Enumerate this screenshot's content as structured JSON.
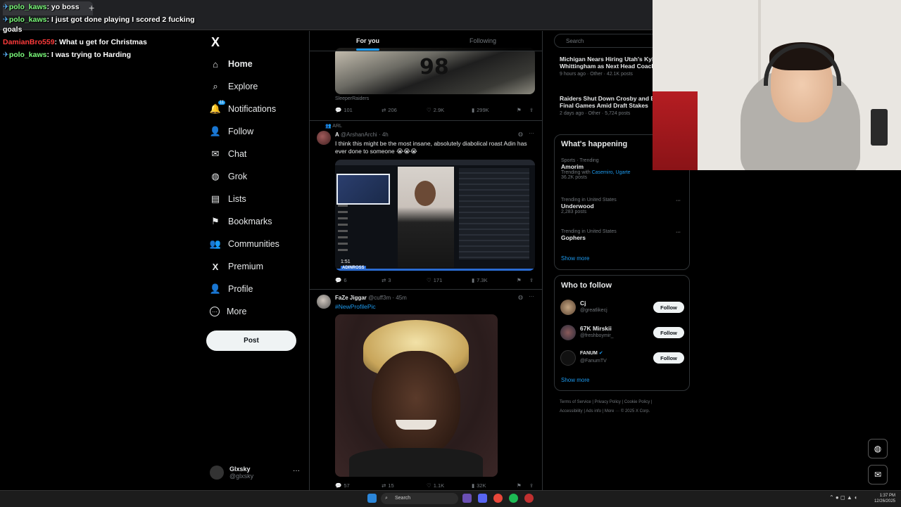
{
  "browser": {
    "tab_label": "",
    "new_tab": "+"
  },
  "chat": [
    {
      "user": "polo_kaws",
      "sep": ":",
      "text": "yo boss",
      "user_color": "green"
    },
    {
      "user": "polo_kaws",
      "sep": ":",
      "text": "I just got done playing I scored 2 fucking",
      "user_color": "green"
    },
    {
      "user": "",
      "sep": "",
      "text": "goals",
      "user_color": "green"
    },
    {
      "user": "DamianBro559",
      "sep": ":",
      "text": "What u get for Christmas",
      "user_color": "red"
    },
    {
      "user": "polo_kaws",
      "sep": ":",
      "text": "I was trying to Harding",
      "user_color": "green"
    }
  ],
  "nav": {
    "logo": "X",
    "items": [
      {
        "label": "Home",
        "icon": "home-icon",
        "glyph": "⌂"
      },
      {
        "label": "Explore",
        "icon": "search-icon",
        "glyph": "⌕"
      },
      {
        "label": "Notifications",
        "icon": "bell-icon",
        "glyph": "🔔"
      },
      {
        "label": "Follow",
        "icon": "add-user-icon",
        "glyph": "👤"
      },
      {
        "label": "Chat",
        "icon": "mail-icon",
        "glyph": "✉"
      },
      {
        "label": "Grok",
        "icon": "grok-icon",
        "glyph": "◍"
      },
      {
        "label": "Lists",
        "icon": "list-icon",
        "glyph": "▤"
      },
      {
        "label": "Bookmarks",
        "icon": "bookmark-icon",
        "glyph": "⚑"
      },
      {
        "label": "Communities",
        "icon": "communities-icon",
        "glyph": "👥"
      },
      {
        "label": "Premium",
        "icon": "x-icon",
        "glyph": "X"
      },
      {
        "label": "Profile",
        "icon": "profile-icon",
        "glyph": "👤"
      },
      {
        "label": "More",
        "icon": "more-icon",
        "glyph": "⋯"
      }
    ],
    "notif_badge": "11",
    "post_label": "Post",
    "account": {
      "name": "Glxsky",
      "handle": "@glxsky",
      "more": "···"
    }
  },
  "feed": {
    "tabs": {
      "for_you": "For you",
      "following": "Following"
    },
    "post0": {
      "source": "SleeperRaiders",
      "jersey": "98",
      "stats": {
        "replies": "101",
        "reposts": "206",
        "likes": "2.9K",
        "views": "299K"
      }
    },
    "post1": {
      "context": "ARL",
      "name": "A",
      "handle": "@ArshanArchi",
      "time": "· 4h",
      "text": "I think this might be the most insane, absolutely diabolical roast Adin has ever done to someone 😭😭😭",
      "video_time": "1:51",
      "overlay_text": "ADINROSS",
      "stats": {
        "replies": "6",
        "reposts": "3",
        "likes": "171",
        "views": "7.3K"
      }
    },
    "post2": {
      "name": "FaZe Jiggar",
      "handle": "@cuff3m",
      "time": "· 45m",
      "text": "#NewProfilePic",
      "stats": {
        "replies": "57",
        "reposts": "15",
        "likes": "1.1K",
        "views": "32K"
      }
    }
  },
  "right": {
    "search_placeholder": "Search",
    "news": [
      {
        "title1": "Michigan Nears Hiring Utah's Kyle",
        "title2": "Whittingham as Next Head Coach",
        "meta": "9 hours ago · Other · 42.1K posts"
      },
      {
        "title1": "Raiders Shut Down Crosby and Be",
        "title2": "Final Games Amid Draft Stakes",
        "meta": "2 days ago · Other · 5,724 posts"
      }
    ],
    "whats_happening": {
      "title": "What's happening",
      "trends": [
        {
          "context": "Sports · Trending",
          "name": "Amorim",
          "extra_prefix": "Trending with ",
          "extra_links": "Casemiro, Ugarte",
          "posts": "36.2K posts"
        },
        {
          "context": "Trending in United States",
          "name": "Underwood",
          "extra_prefix": "",
          "extra_links": "",
          "posts": "2,283 posts"
        },
        {
          "context": "Trending in United States",
          "name": "Gophers",
          "extra_prefix": "",
          "extra_links": "",
          "posts": ""
        }
      ],
      "show_more": "Show more"
    },
    "who_to_follow": {
      "title": "Who to follow",
      "users": [
        {
          "name": "Cj",
          "handle": "@greatlikecj",
          "button": "Follow"
        },
        {
          "name": "67K Mirskii",
          "handle": "@freshboymir_",
          "button": "Follow"
        },
        {
          "name": "FANUM",
          "handle": "@FanumTV",
          "button": "Follow"
        }
      ],
      "show_more": "Show more"
    },
    "footer": [
      "Terms of Service",
      "Privacy Policy",
      "Cookie Policy",
      "Accessibility",
      "Ads info",
      "More ···",
      "© 2025 X Corp."
    ]
  },
  "taskbar": {
    "search": "Search",
    "time": "1:37 PM",
    "date": "12/26/2025"
  },
  "colors": {
    "accent": "#1d9bf0",
    "bg": "#000000",
    "border": "#2f3336",
    "muted": "#71767b"
  }
}
